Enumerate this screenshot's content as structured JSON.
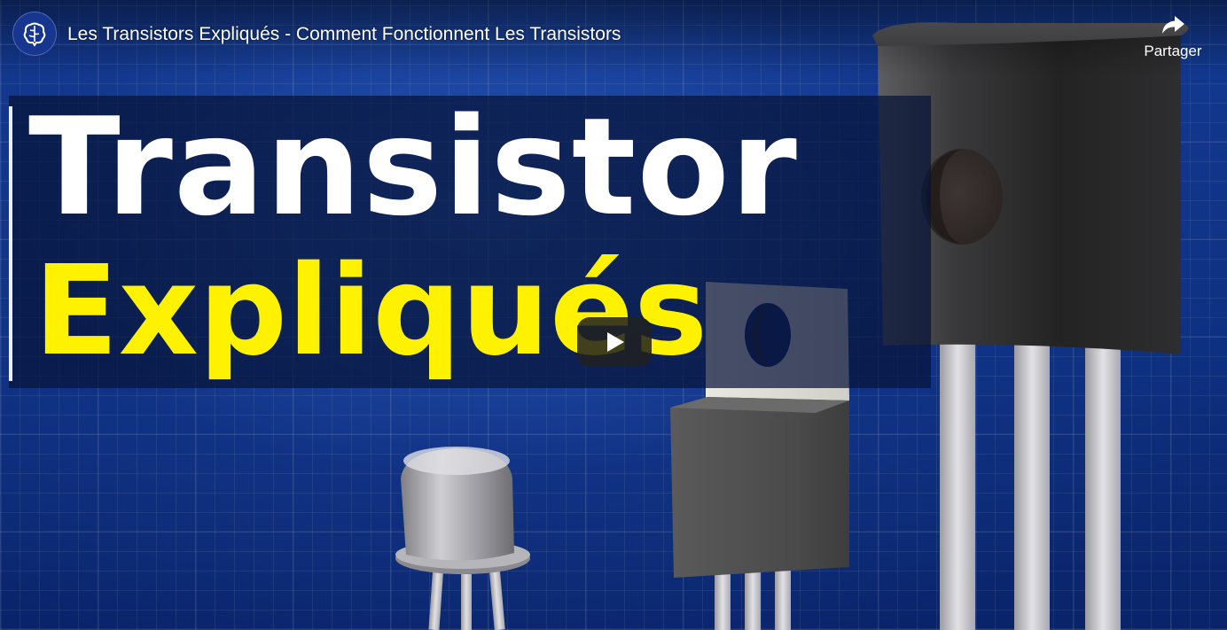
{
  "header": {
    "video_title": "Les Transistors Expliqués - Comment Fonctionnent Les Transistors",
    "share_label": "Partager",
    "channel_avatar_icon": "brain-logo-icon",
    "share_icon": "share-arrow-icon"
  },
  "thumbnail": {
    "headline_line1": "Transistor",
    "headline_line2": "Expliqués",
    "headline_line1_color": "#ffffff",
    "headline_line2_color": "#fff200",
    "background_color": "#123a93"
  },
  "controls": {
    "play_icon": "play-icon"
  },
  "illustrations": [
    "to92-transistor-illustration",
    "to220-transistor-illustration",
    "to18-metal-can-transistor-illustration"
  ]
}
